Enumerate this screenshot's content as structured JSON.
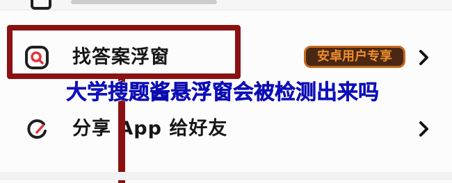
{
  "menu": {
    "items": [
      {
        "label": "找答案浮窗",
        "icon": "search-magnifier-icon",
        "badge": "安卓用户专享",
        "chevron": "›"
      },
      {
        "label": "分享 App 给好友",
        "icon": "share-refresh-icon",
        "chevron": "›"
      }
    ]
  },
  "overlay": {
    "caption": "大学搜题酱悬浮窗会被检测出来吗"
  },
  "colors": {
    "highlight": "#8a1212",
    "badge_bg": "#4a2712",
    "badge_text": "#ee8f2d",
    "caption": "#1414d9",
    "icon_accent": "#e8313a",
    "icon_dark": "#1f1f22"
  }
}
